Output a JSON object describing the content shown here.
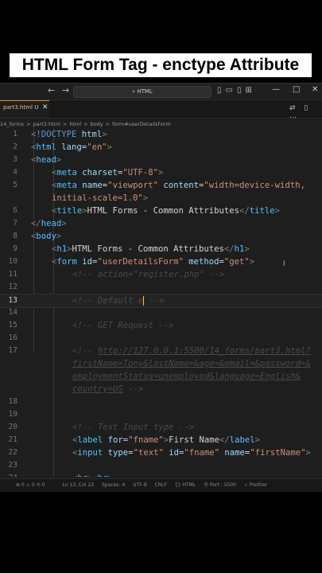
{
  "banner": {
    "title": "HTML Form Tag - enctype Attribute"
  },
  "titlebar": {
    "search": "HTML",
    "back_icon": "←",
    "forward_icon": "→",
    "layout_icons": "▯▭▯⊞",
    "minimize": "—",
    "maximize": "□",
    "close": "✕"
  },
  "tab": {
    "label": "part3.html U",
    "close": "✕",
    "actions": "⇄ ▯ …"
  },
  "breadcrumb": [
    "14_forms",
    ">",
    "part3.html",
    ">",
    "html",
    ">",
    "body",
    ">",
    "form#userDetailsForm"
  ],
  "code_lines": [
    {
      "n": "1",
      "indent": 0,
      "seg": [
        [
          "br",
          "<"
        ],
        [
          "doc",
          "!DOCTYPE"
        ],
        [
          "attr",
          " html"
        ],
        [
          "br",
          ">"
        ]
      ]
    },
    {
      "n": "2",
      "indent": 0,
      "seg": [
        [
          "br",
          "<"
        ],
        [
          "tag",
          "html"
        ],
        [
          "attr",
          " lang"
        ],
        [
          "text",
          "="
        ],
        [
          "str",
          "\"en\""
        ],
        [
          "br",
          ">"
        ]
      ]
    },
    {
      "n": "3",
      "indent": 0,
      "seg": [
        [
          "br",
          "<"
        ],
        [
          "tag",
          "head"
        ],
        [
          "br",
          ">"
        ]
      ]
    },
    {
      "n": "4",
      "indent": 1,
      "seg": [
        [
          "br",
          "<"
        ],
        [
          "tag",
          "meta"
        ],
        [
          "attr",
          " charset"
        ],
        [
          "text",
          "="
        ],
        [
          "str",
          "\"UTF-8\""
        ],
        [
          "br",
          ">"
        ]
      ]
    },
    {
      "n": "5",
      "indent": 1,
      "seg": [
        [
          "br",
          "<"
        ],
        [
          "tag",
          "meta"
        ],
        [
          "attr",
          " name"
        ],
        [
          "text",
          "="
        ],
        [
          "str",
          "\"viewport\""
        ],
        [
          "attr",
          " content"
        ],
        [
          "text",
          "="
        ],
        [
          "str",
          "\"width=device-width,"
        ]
      ]
    },
    {
      "n": "",
      "indent": 1,
      "seg": [
        [
          "str",
          "initial-scale=1.0\""
        ],
        [
          "br",
          ">"
        ]
      ]
    },
    {
      "n": "6",
      "indent": 1,
      "seg": [
        [
          "br",
          "<"
        ],
        [
          "tag",
          "title"
        ],
        [
          "br",
          ">"
        ],
        [
          "text",
          "HTML Forms - Common Attributes"
        ],
        [
          "br",
          "</"
        ],
        [
          "tag",
          "title"
        ],
        [
          "br",
          ">"
        ]
      ]
    },
    {
      "n": "7",
      "indent": 0,
      "seg": [
        [
          "br",
          "</"
        ],
        [
          "tag",
          "head"
        ],
        [
          "br",
          ">"
        ]
      ]
    },
    {
      "n": "8",
      "indent": 0,
      "seg": [
        [
          "br",
          "<"
        ],
        [
          "tag",
          "body"
        ],
        [
          "br",
          ">"
        ]
      ]
    },
    {
      "n": "9",
      "indent": 1,
      "seg": [
        [
          "br",
          "<"
        ],
        [
          "tag",
          "h1"
        ],
        [
          "br",
          ">"
        ],
        [
          "text",
          "HTML Forms - Common Attributes"
        ],
        [
          "br",
          "</"
        ],
        [
          "tag",
          "h1"
        ],
        [
          "br",
          ">"
        ]
      ]
    },
    {
      "n": "10",
      "indent": 1,
      "seg": [
        [
          "br",
          "<"
        ],
        [
          "tag",
          "form"
        ],
        [
          "attr",
          " id"
        ],
        [
          "text",
          "="
        ],
        [
          "str",
          "\"userDetailsForm\""
        ],
        [
          "attr",
          " method"
        ],
        [
          "text",
          "="
        ],
        [
          "str",
          "\"get\""
        ],
        [
          "br",
          ">"
        ]
      ]
    },
    {
      "n": "11",
      "indent": 2,
      "seg": [
        [
          "cm",
          "<!-- action=\"register.php\" -->"
        ]
      ]
    },
    {
      "n": "12",
      "indent": 0,
      "seg": []
    },
    {
      "n": "13",
      "indent": 2,
      "current": true,
      "seg": [
        [
          "cm",
          "<!-- Default e"
        ],
        [
          "cursor",
          ""
        ],
        [
          "cm",
          " -->"
        ]
      ]
    },
    {
      "n": "14",
      "indent": 0,
      "seg": []
    },
    {
      "n": "15",
      "indent": 2,
      "seg": [
        [
          "cm",
          "<!-- GET Request -->"
        ]
      ]
    },
    {
      "n": "16",
      "indent": 0,
      "seg": []
    },
    {
      "n": "17",
      "indent": 2,
      "seg": [
        [
          "cm",
          "<!-- "
        ],
        [
          "cmlink",
          "http://127.0.0.1:5500/14_forms/part3.html?"
        ]
      ]
    },
    {
      "n": "",
      "indent": 2,
      "seg": [
        [
          "cmlink",
          "firstName=Tony&lastName=&age=&email=&password=&"
        ]
      ]
    },
    {
      "n": "",
      "indent": 2,
      "seg": [
        [
          "cmlink",
          "employmentStatus=unemployed&language=English&"
        ]
      ]
    },
    {
      "n": "",
      "indent": 2,
      "seg": [
        [
          "cmlink",
          "country=US"
        ],
        [
          "cm",
          " -->"
        ]
      ]
    },
    {
      "n": "18",
      "indent": 0,
      "seg": []
    },
    {
      "n": "19",
      "indent": 0,
      "seg": []
    },
    {
      "n": "20",
      "indent": 2,
      "seg": [
        [
          "cm",
          "<!-- Text Input type -->"
        ]
      ]
    },
    {
      "n": "21",
      "indent": 2,
      "seg": [
        [
          "br",
          "<"
        ],
        [
          "tag",
          "label"
        ],
        [
          "attr",
          " for"
        ],
        [
          "text",
          "="
        ],
        [
          "str",
          "\"fname\""
        ],
        [
          "br",
          ">"
        ],
        [
          "text",
          "First Name"
        ],
        [
          "br",
          "</"
        ],
        [
          "tag",
          "label"
        ],
        [
          "br",
          ">"
        ]
      ]
    },
    {
      "n": "22",
      "indent": 2,
      "seg": [
        [
          "br",
          "<"
        ],
        [
          "tag",
          "input"
        ],
        [
          "attr",
          " type"
        ],
        [
          "text",
          "="
        ],
        [
          "str",
          "\"text\""
        ],
        [
          "attr",
          " id"
        ],
        [
          "text",
          "="
        ],
        [
          "str",
          "\"fname\""
        ],
        [
          "attr",
          " name"
        ],
        [
          "text",
          "="
        ],
        [
          "str",
          "\"firstName\""
        ],
        [
          "br",
          ">"
        ]
      ]
    },
    {
      "n": "23",
      "indent": 0,
      "seg": []
    },
    {
      "n": "24",
      "indent": 2,
      "seg": [
        [
          "br",
          "<"
        ],
        [
          "tag",
          "br"
        ],
        [
          "br",
          "><"
        ],
        [
          "tag",
          "br"
        ],
        [
          "br",
          ">"
        ]
      ]
    }
  ],
  "status": [
    "⊗ 0 ⚠ 0  ⟲ 0",
    "Ln 13, Col 23",
    "Spaces: 4",
    "UTF-8",
    "CRLF",
    "{} HTML",
    "⦿ Port : 5500",
    "✓ Prettier"
  ]
}
